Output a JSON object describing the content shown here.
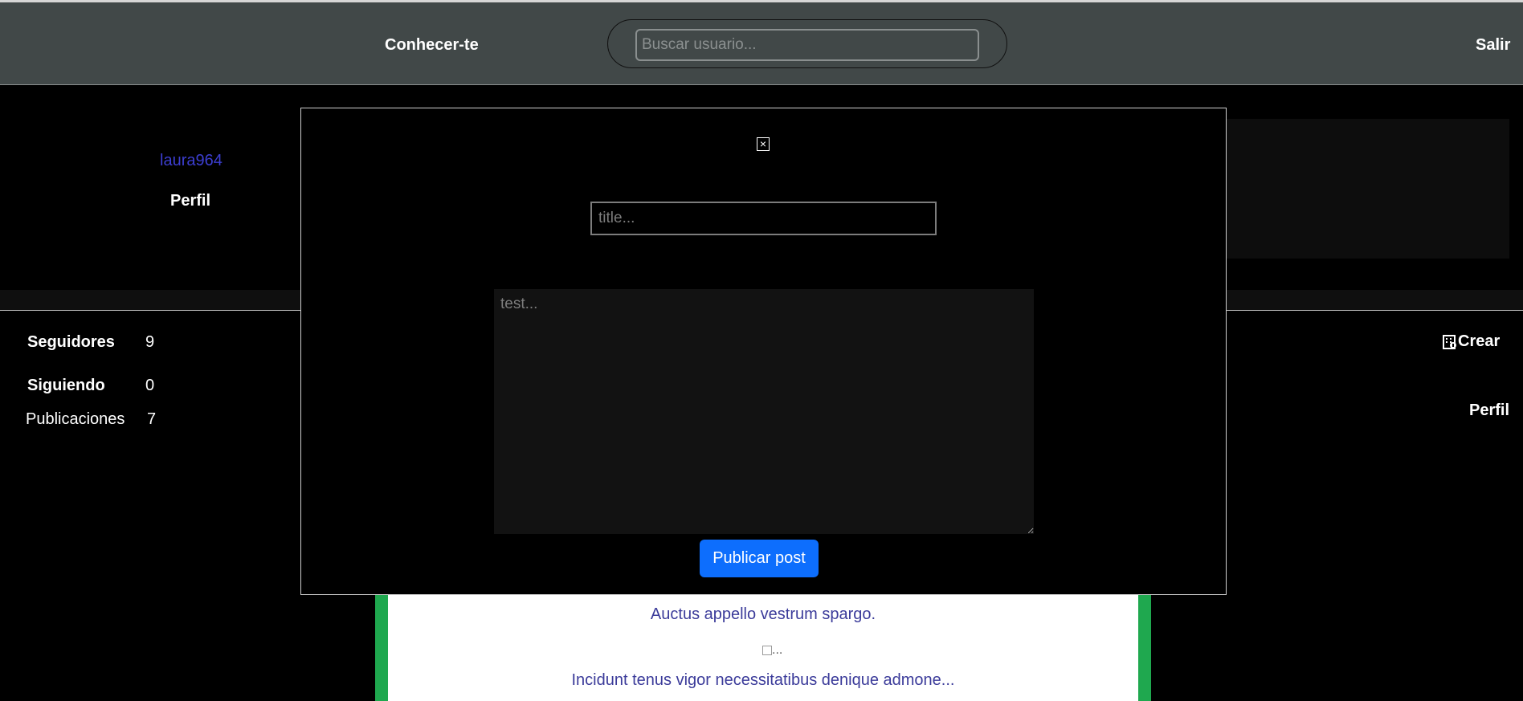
{
  "topbar": {
    "brand": "Conhecer-te",
    "search_placeholder": "Buscar usuario...",
    "logout_label": "Salir"
  },
  "sidebar": {
    "username": "laura964",
    "profile_label": "Perfil",
    "stats": [
      {
        "label": "Seguidores",
        "value": "9"
      },
      {
        "label": "Siguiendo",
        "value": "0"
      },
      {
        "label": "Publicaciones",
        "value": "7"
      }
    ]
  },
  "right_menu": {
    "create_label": "Crear",
    "create_icon": "building-icon",
    "profile_label": "Perfil"
  },
  "feed": {
    "post_title": "Auctus appello vestrum spargo.",
    "image_alt": "...",
    "post_excerpt": "Incidunt tenus vigor necessitatibus denique admone..."
  },
  "modal": {
    "close_glyph": "×",
    "title_placeholder": "title...",
    "body_placeholder": "test...",
    "publish_label": "Publicar post"
  },
  "colors": {
    "topbar_bg": "#414848",
    "accent_blue": "#0d6efd",
    "username_link": "#3c3ed0",
    "card_border": "#1fa84f"
  }
}
